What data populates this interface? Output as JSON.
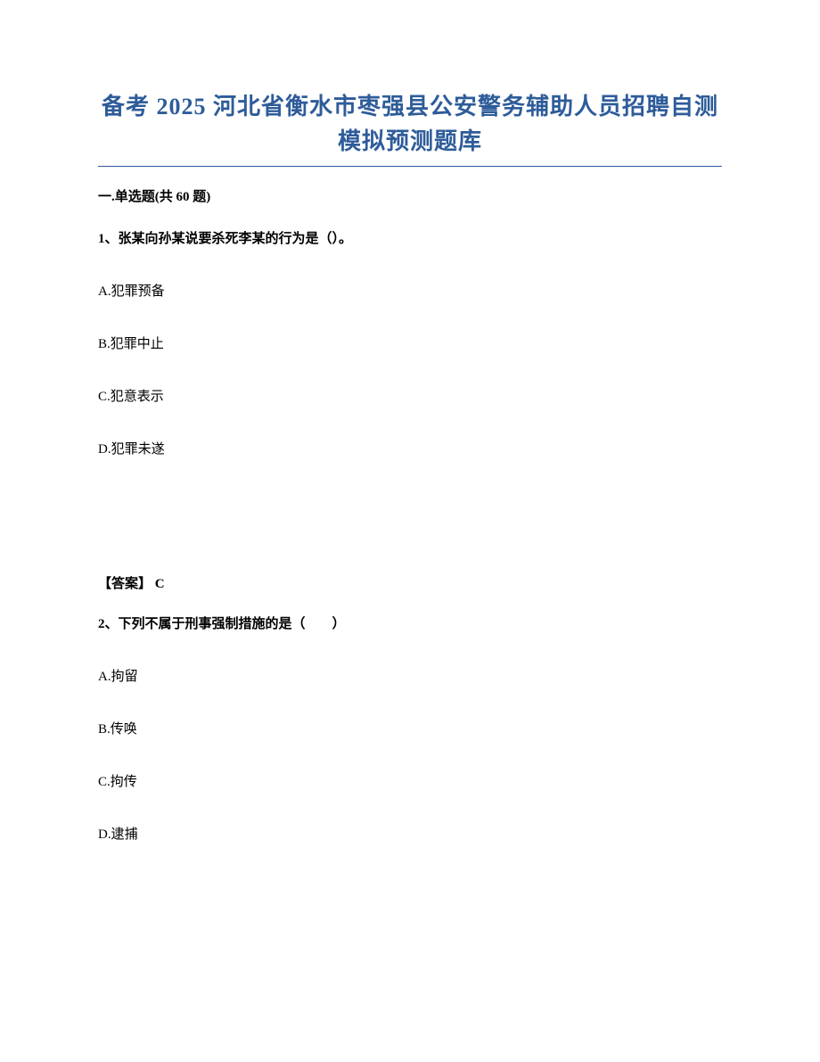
{
  "title_line1": "备考 2025 河北省衡水市枣强县公安警务辅助人员招聘自测",
  "title_line2": "模拟预测题库",
  "section_header": "一.单选题(共 60 题)",
  "q1": {
    "text": "1、张某向孙某说要杀死李某的行为是（）。",
    "optA": "A.犯罪预备",
    "optB": "B.犯罪中止",
    "optC": "C.犯意表示",
    "optD": "D.犯罪未遂",
    "answer": "【答案】  C"
  },
  "q2": {
    "text": "2、下列不属于刑事强制措施的是（　　）",
    "optA": "A.拘留",
    "optB": "B.传唤",
    "optC": "C.拘传",
    "optD": "D.逮捕"
  }
}
